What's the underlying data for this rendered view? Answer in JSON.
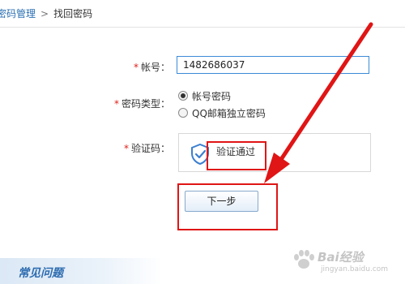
{
  "breadcrumb": {
    "parent": "密码管理",
    "separator": ">",
    "current": "找回密码"
  },
  "form": {
    "required_mark": "*",
    "account": {
      "label": "帐号：",
      "value": "1482686037"
    },
    "password_type": {
      "label": "密码类型：",
      "options": [
        {
          "label": "帐号密码",
          "selected": true
        },
        {
          "label": "QQ邮箱独立密码",
          "selected": false
        }
      ]
    },
    "captcha": {
      "label": "验证码：",
      "status_text": "验证通过",
      "icon": "shield-check-icon"
    },
    "next_button_label": "下一步"
  },
  "faq": {
    "title": "常见问题"
  },
  "watermark": {
    "main": "Bai经验",
    "sub": "jingyan.baidu.com"
  },
  "colors": {
    "accent_blue": "#2a6fb3",
    "input_border": "#3c8ad8",
    "required_red": "#e0201a",
    "annotation_red": "#e01515"
  }
}
